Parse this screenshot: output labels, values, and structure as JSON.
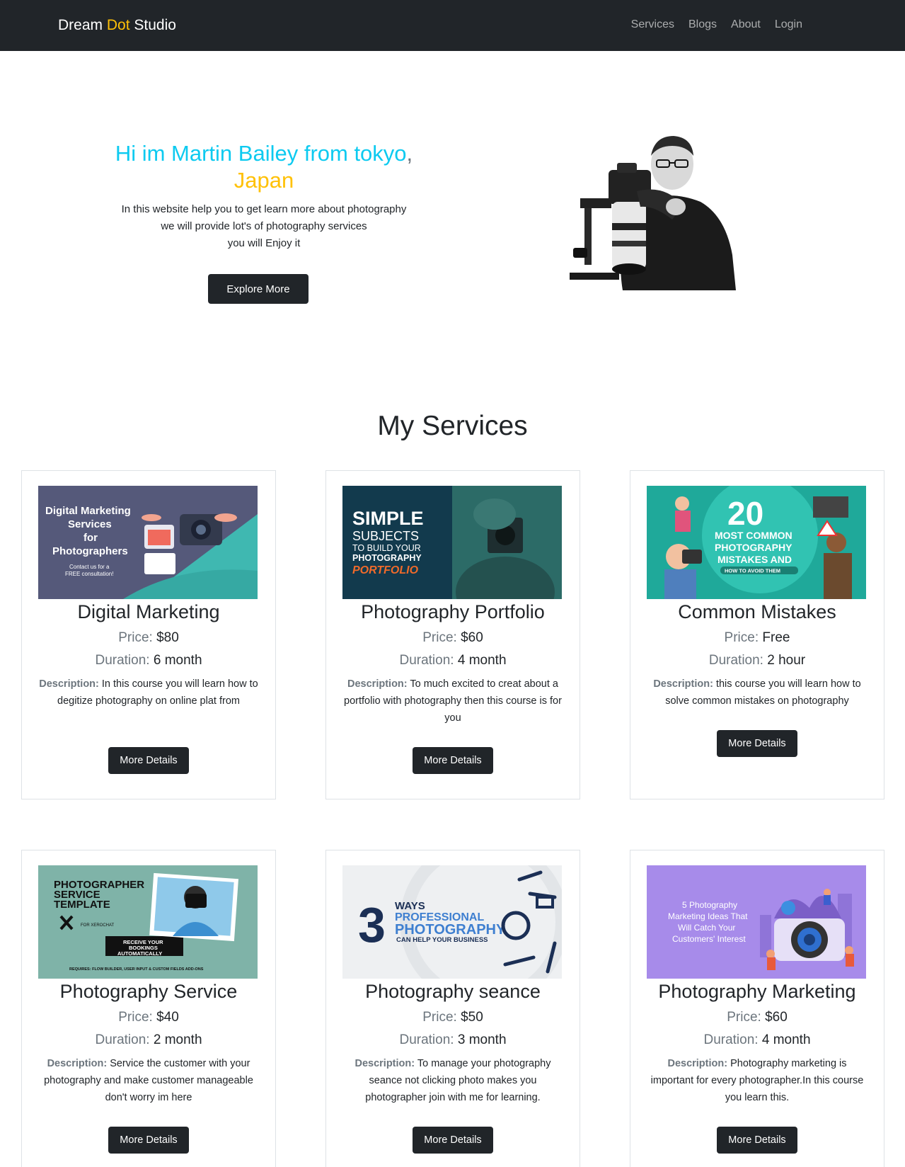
{
  "navbar": {
    "brand": {
      "part1": "Dream ",
      "part2": "Dot",
      "part3": " Studio"
    },
    "links": [
      "Services",
      "Blogs",
      "About",
      "Login"
    ]
  },
  "hero": {
    "title_main": "Hi im Martin Bailey from tokyo",
    "title_sep": ",",
    "title_country": "Japan",
    "lines": [
      "In this website help you to get learn more about photography",
      "we will provide lot's of photography services",
      "you will Enjoy it"
    ],
    "button": "Explore More"
  },
  "services": {
    "title": "My Services",
    "price_label": "Price:",
    "duration_label": "Duration:",
    "description_label": "Description:",
    "button_label": "More Details",
    "items": [
      {
        "title": "Digital Marketing",
        "price": "$80",
        "duration": "6 month",
        "description": "In this course you will learn how to degitize photography on online plat from",
        "image_text": [
          "Digital Marketing",
          "Services",
          "for",
          "Photographers",
          "Contact us for a",
          "FREE consultation!"
        ]
      },
      {
        "title": "Photography Portfolio",
        "price": "$60",
        "duration": "4 month",
        "description": "To much excited to creat about a portfolio with photography then this course is for you",
        "image_text": [
          "SIMPLE",
          "SUBJECTS",
          "TO BUILD YOUR",
          "PHOTOGRAPHY",
          "PORTFOLIO"
        ]
      },
      {
        "title": "Common Mistakes",
        "price": "Free",
        "duration": "2 hour",
        "description": "this course you will learn how to solve common mistakes on photography",
        "image_text": [
          "20",
          "MOST COMMON",
          "PHOTOGRAPHY",
          "MISTAKES AND",
          "HOW TO AVOID THEM"
        ]
      },
      {
        "title": "Photography Service",
        "price": "$40",
        "duration": "2 month",
        "description": "Service the customer with your photography and make customer manageable don't worry im here",
        "image_text": [
          "PHOTOGRAPHER",
          "SERVICE",
          "TEMPLATE",
          "FOR XEROCHAT",
          "RECEIVE YOUR",
          "BOOKINGS",
          "AUTOMATICALLY",
          "REQUIRES: FLOW BUILDER, USER INPUT & CUSTOM FIELDS ADD-ONS"
        ]
      },
      {
        "title": "Photography seance",
        "price": "$50",
        "duration": "3 month",
        "description": "To manage your photography seance not clicking photo makes you photographer join with me for learning.",
        "image_text": [
          "3",
          "WAYS",
          "PROFESSIONAL",
          "PHOTOGRAPHY",
          "CAN HELP YOUR BUSINESS"
        ]
      },
      {
        "title": "Photography Marketing",
        "price": "$60",
        "duration": "4 month",
        "description": "Photography marketing is important for every photographer.In this course you learn this.",
        "image_text": [
          "5 Photography",
          "Marketing Ideas That",
          "Will Catch Your",
          "Customers' Interest"
        ]
      }
    ]
  },
  "colors": {
    "navbar_bg": "#212529",
    "accent_yellow": "#ffc107",
    "accent_cyan": "#0dcaf0",
    "muted": "#6c757d"
  }
}
